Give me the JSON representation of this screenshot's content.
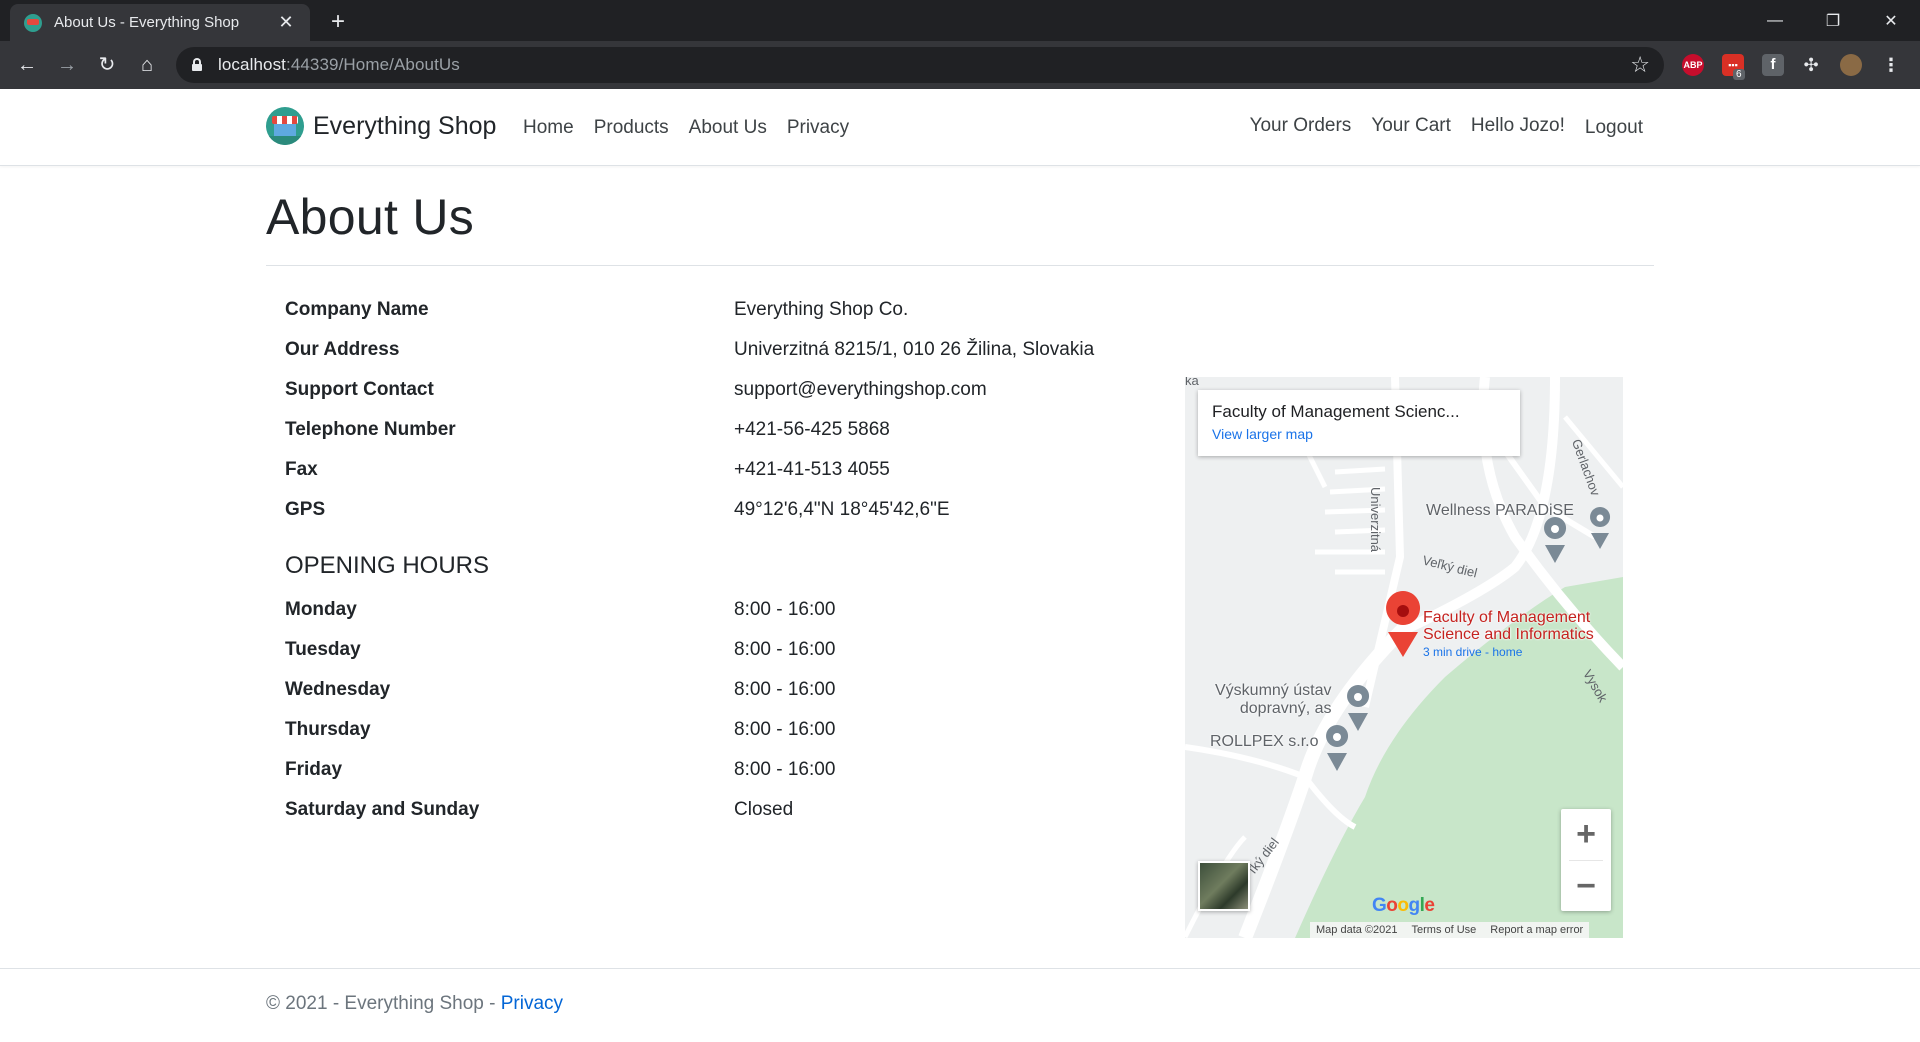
{
  "browser": {
    "tab_title": "About Us - Everything Shop",
    "url_host": "localhost",
    "url_path": ":44339/Home/AboutUs",
    "ext_badge": "6",
    "ext_abp": "ABP"
  },
  "navbar": {
    "brand": "Everything Shop",
    "links": [
      "Home",
      "Products",
      "About Us",
      "Privacy"
    ],
    "right_links": [
      "Your Orders",
      "Your Cart",
      "Hello Jozo!",
      "Logout"
    ]
  },
  "main": {
    "title": "About Us",
    "company": [
      {
        "label": "Company Name",
        "value": "Everything Shop Co."
      },
      {
        "label": "Our Address",
        "value": "Univerzitná 8215/1, 010 26 Žilina, Slovakia"
      },
      {
        "label": "Support Contact",
        "value": "support@everythingshop.com"
      },
      {
        "label": "Telephone Number",
        "value": "+421-56-425 5868"
      },
      {
        "label": "Fax",
        "value": "+421-41-513 4055"
      },
      {
        "label": "GPS",
        "value": "49°12'6,4\"N 18°45'42,6\"E"
      }
    ],
    "hours_heading": "OPENING HOURS",
    "hours": [
      {
        "label": "Monday",
        "value": "8:00 - 16:00"
      },
      {
        "label": "Tuesday",
        "value": "8:00 - 16:00"
      },
      {
        "label": "Wednesday",
        "value": "8:00 - 16:00"
      },
      {
        "label": "Thursday",
        "value": "8:00 - 16:00"
      },
      {
        "label": "Friday",
        "value": "8:00 - 16:00"
      },
      {
        "label": "Saturday and Sunday",
        "value": "Closed"
      }
    ]
  },
  "map": {
    "card_title": "Faculty of Management Scienc...",
    "card_link": "View larger map",
    "place_name_line1": "Faculty of Management",
    "place_name_line2": "Science and Informatics",
    "place_sublink": "3 min drive - home",
    "poi_wellness": "Wellness PARADiSE",
    "poi_vyskumny_1": "Výskumný ústav",
    "poi_vyskumny_2": "dopravný, as",
    "poi_rollpex": "ROLLPEX s.r.o",
    "road_velky_diel": "Veľký diel",
    "road_velky_diel_2": "ľký diel",
    "road_univerzitna": "Univerzitná",
    "road_vysok": "Vysok",
    "road_gerlachov": "Gerlachov",
    "road_ka": "ka",
    "google": "Google",
    "footer": [
      "Map data ©2021",
      "Terms of Use",
      "Report a map error"
    ]
  },
  "footer": {
    "copyright": "© 2021 - Everything Shop - ",
    "privacy_link": "Privacy"
  },
  "colors": {
    "browser_dark": "#202124",
    "browser_toolbar": "#35363a",
    "map_green": "#c8e6c9",
    "map_pin": "#ea4335",
    "link_blue": "#0366d6"
  }
}
